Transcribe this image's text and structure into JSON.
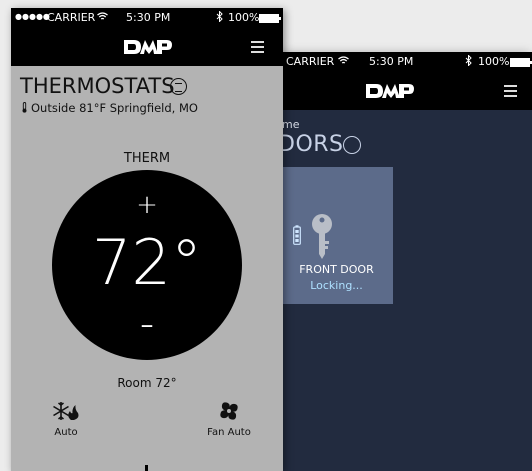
{
  "back_phone": {
    "statusbar": {
      "carrier": "CARRIER",
      "time": "5:30 PM",
      "battery": "100%"
    },
    "breadcrumb": "me",
    "title": "DORS",
    "doors": [
      {
        "name": "FRONT DOOR",
        "status": "Locking..."
      }
    ]
  },
  "front_phone": {
    "statusbar": {
      "signal": "●●●●●",
      "carrier": "CARRIER",
      "time": "5:30 PM",
      "battery": "100%"
    },
    "brand": "DMP",
    "title": "THERMOSTATS",
    "outside": "Outside 81°F Springfield, MO",
    "thermostat": {
      "name": "THERM",
      "setpoint": "72°",
      "increase_label": "+",
      "decrease_label": "–",
      "room": "Room 72°"
    },
    "modes": {
      "system_label": "Auto",
      "fan_label": "Fan Auto"
    }
  },
  "colors": {
    "front_bg": "#b3b3b3",
    "back_bg": "#222b3f",
    "door_tile": "#5c6b8a",
    "status_accent": "#aee0ff"
  },
  "icons": [
    "wifi-icon",
    "bluetooth-icon",
    "battery-icon",
    "menu-icon",
    "list-icon",
    "thermometer-icon",
    "key-icon",
    "heat-cool-icon",
    "fan-icon"
  ]
}
